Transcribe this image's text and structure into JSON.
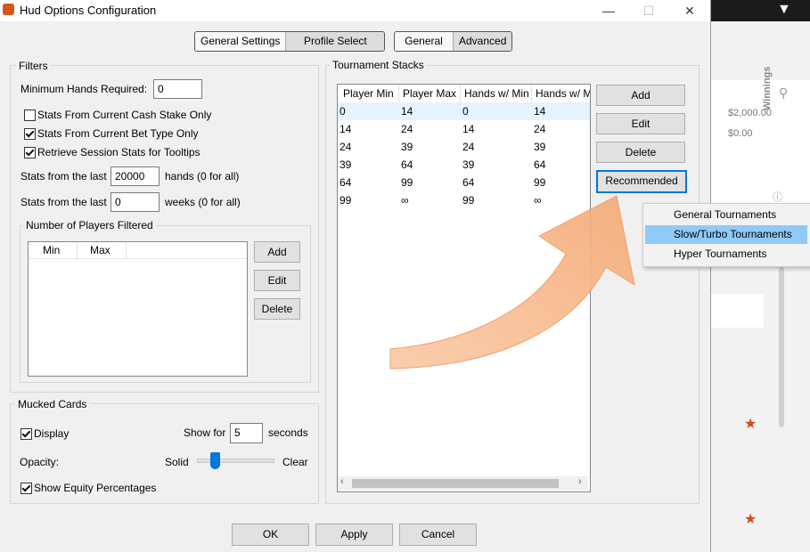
{
  "window": {
    "title": "Hud Options Configuration"
  },
  "segments_left": [
    "General Settings",
    "Profile Select"
  ],
  "segments_right": [
    "General",
    "Advanced"
  ],
  "filters": {
    "title": "Filters",
    "min_hands_label": "Minimum Hands Required:",
    "min_hands_value": "0",
    "cb1": "Stats From Current Cash Stake Only",
    "cb2": "Stats From Current Bet Type Only",
    "cb3": "Retrieve Session Stats for Tooltips",
    "stats_from_last": "Stats from the last",
    "hands_value": "20000",
    "hands_suffix": "hands (0 for all)",
    "weeks_value": "0",
    "weeks_suffix": "weeks (0 for all)",
    "players_title": "Number of Players Filtered",
    "players_cols": [
      "Min",
      "Max"
    ],
    "add": "Add",
    "edit": "Edit",
    "delete": "Delete"
  },
  "mucked": {
    "title": "Mucked Cards",
    "display": "Display",
    "show_for": "Show for",
    "show_value": "5",
    "seconds": "seconds",
    "opacity": "Opacity:",
    "solid": "Solid",
    "clear": "Clear",
    "equity": "Show Equity Percentages"
  },
  "stacks": {
    "title": "Tournament Stacks",
    "columns": [
      "Player Min",
      "Player Max",
      "Hands w/ Min",
      "Hands w/ M"
    ],
    "rows": [
      [
        "0",
        "14",
        "0",
        "14"
      ],
      [
        "14",
        "24",
        "14",
        "24"
      ],
      [
        "24",
        "39",
        "24",
        "39"
      ],
      [
        "39",
        "64",
        "39",
        "64"
      ],
      [
        "64",
        "99",
        "64",
        "99"
      ],
      [
        "99",
        "∞",
        "99",
        "∞"
      ]
    ],
    "add": "Add",
    "edit": "Edit",
    "delete": "Delete",
    "recommended": "Recommended"
  },
  "menu": [
    "General Tournaments",
    "Slow/Turbo Tournaments",
    "Hyper Tournaments"
  ],
  "footer": {
    "ok": "OK",
    "apply": "Apply",
    "cancel": "Cancel"
  },
  "bgapp": {
    "amount1": "$2,000.00",
    "amount2": "$0.00",
    "vertical": "Winnings"
  },
  "colors": {
    "accent": "#0078d7",
    "menu_highlight": "#91c9f7",
    "arrow": "#f7b88a"
  }
}
